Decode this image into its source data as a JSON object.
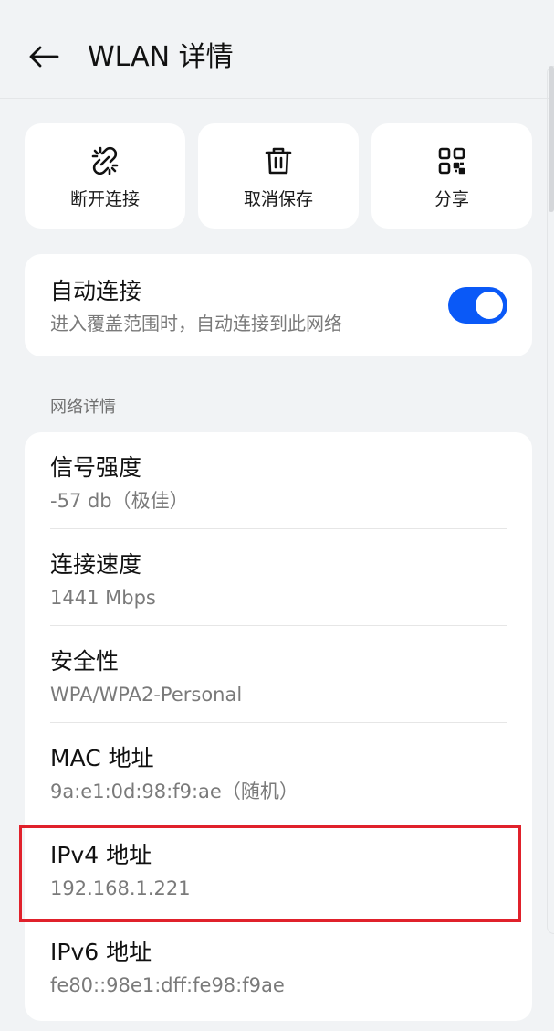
{
  "header": {
    "title": "WLAN 详情",
    "back_icon": "arrow-left-icon"
  },
  "actions": [
    {
      "label": "断开连接",
      "icon": "broken-link-icon"
    },
    {
      "label": "取消保存",
      "icon": "trash-icon"
    },
    {
      "label": "分享",
      "icon": "qr-code-icon"
    }
  ],
  "auto_connect": {
    "title": "自动连接",
    "subtitle": "进入覆盖范围时，自动连接到此网络",
    "enabled": true
  },
  "section": {
    "title": "网络详情"
  },
  "details": [
    {
      "title": "信号强度",
      "value": "-57 db（极佳）"
    },
    {
      "title": "连接速度",
      "value": "1441 Mbps"
    },
    {
      "title": "安全性",
      "value": "WPA/WPA2-Personal"
    },
    {
      "title": "MAC 地址",
      "value": "9a:e1:0d:98:f9:ae（随机）"
    },
    {
      "title": "IPv4 地址",
      "value": "192.168.1.221"
    },
    {
      "title": "IPv6 地址",
      "value": "fe80::98e1:dff:fe98:f9ae"
    }
  ],
  "colors": {
    "accent": "#0a59f7",
    "highlight": "#e0212b",
    "background": "#f1f3f5"
  }
}
